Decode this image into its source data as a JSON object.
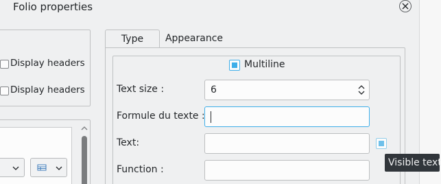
{
  "window": {
    "title": "Folio properties",
    "close_icon": "close-icon"
  },
  "left_panel": {
    "checkboxes": [
      {
        "label": "Display headers",
        "checked": false
      },
      {
        "label": "Display headers",
        "checked": false
      }
    ],
    "lower_combo_icon": "table-icon"
  },
  "tabs": [
    {
      "label": "Type",
      "active": true
    },
    {
      "label": "Appearance",
      "active": false
    }
  ],
  "form": {
    "multiline": {
      "label": "Multiline",
      "checked": true
    },
    "text_size": {
      "label": "Text size :",
      "value": "6"
    },
    "formula": {
      "label": "Formule du texte :",
      "value": ""
    },
    "text": {
      "label": "Text:",
      "value": ""
    },
    "function": {
      "label": "Function :",
      "value": ""
    },
    "visible_checked": true
  },
  "tooltip": {
    "text": "Visible text"
  },
  "colors": {
    "accent": "#3daee9",
    "window_bg": "#eff0f1",
    "tooltip_bg": "#31363b"
  }
}
